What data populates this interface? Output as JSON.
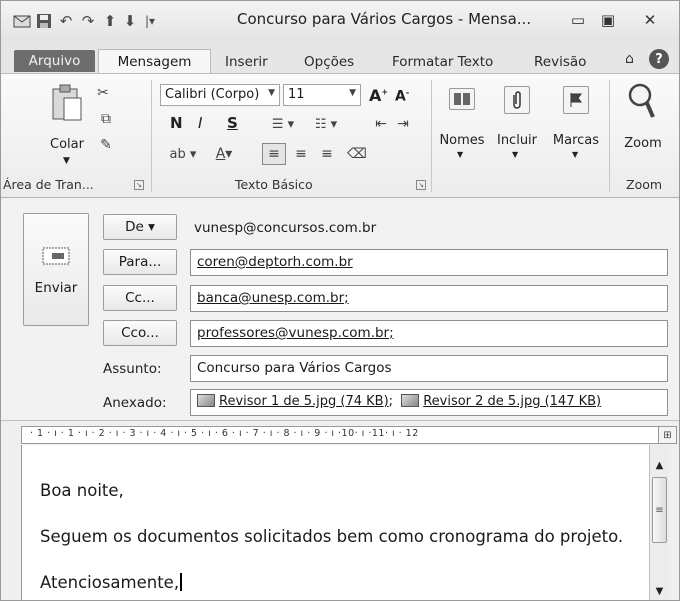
{
  "window": {
    "title": "Concurso para Vários Cargos - Mensa...",
    "qat_icons": [
      "outlook-app-icon",
      "save-icon",
      "undo-icon",
      "redo-icon",
      "up-arrow-icon",
      "down-arrow-icon",
      "customize-qat-icon"
    ],
    "controls": {
      "minimize": "▭",
      "maximize": "▣",
      "close": "✕"
    }
  },
  "tabs": {
    "file": "Arquivo",
    "active": "Mensagem",
    "items": [
      "Inserir",
      "Opções",
      "Formatar Texto",
      "Revisão"
    ]
  },
  "ribbon": {
    "clipboard": {
      "paste": "Colar",
      "label": "Área de Tran..."
    },
    "basic_text": {
      "font": "Calibri (Corpo)",
      "size": "11",
      "bold": "N",
      "italic": "I",
      "underline": "S",
      "label": "Texto Básico"
    },
    "names": {
      "label": "Nomes"
    },
    "include": {
      "label": "Incluir"
    },
    "tags": {
      "label": "Marcas"
    },
    "zoom": {
      "button": "Zoom",
      "label": "Zoom"
    }
  },
  "header": {
    "send": "Enviar",
    "from_button": "De ▾",
    "from_value": "vunesp@concursos.com.br",
    "to_button": "Para...",
    "to_value": "coren@deptorh.com.br",
    "cc_button": "Cc...",
    "cc_value": "banca@unesp.com.br;",
    "bcc_button": "Cco...",
    "bcc_value": "professores@vunesp.com.br;",
    "subject_label": "Assunto:",
    "subject_value": "Concurso para Vários Cargos",
    "attached_label": "Anexado:",
    "attachments": [
      {
        "name": "Revisor 1 de 5.jpg (74 KB)",
        "sep": ";"
      },
      {
        "name": "Revisor 2 de 5.jpg (147 KB)"
      }
    ]
  },
  "ruler": {
    "text": "· 1 · ı · 1 · ı · 2 · ı · 3 · ı · 4 · ı · 5 · ı · 6 · ı · 7 · ı · 8 · ı · 9 · ı ·10· ı ·11· ı · 12"
  },
  "body": {
    "lines": [
      "Boa noite,",
      "Seguem os documentos solicitados bem como cronograma do projeto.",
      "Atenciosamente,"
    ]
  }
}
